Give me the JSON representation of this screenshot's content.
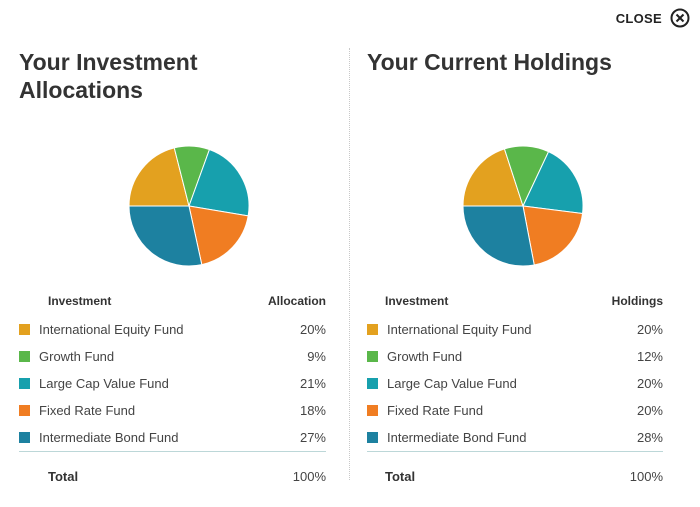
{
  "close": {
    "label": "CLOSE"
  },
  "left": {
    "title_line1": "Your Investment",
    "title_line2": "Allocations",
    "col_investment": "Investment",
    "col_value": "Allocation",
    "rows": [
      {
        "name": "International Equity Fund",
        "value": "20%",
        "color": "#e3a11f"
      },
      {
        "name": "Growth Fund",
        "value": "9%",
        "color": "#5ab74a"
      },
      {
        "name": "Large Cap Value Fund",
        "value": "21%",
        "color": "#17a0ad"
      },
      {
        "name": "Fixed Rate Fund",
        "value": "18%",
        "color": "#f07d22"
      },
      {
        "name": "Intermediate Bond Fund",
        "value": "27%",
        "color": "#1d81a0"
      }
    ],
    "total_label": "Total",
    "total_value": "100%"
  },
  "right": {
    "title": "Your Current Holdings",
    "col_investment": "Investment",
    "col_value": "Holdings",
    "rows": [
      {
        "name": "International Equity Fund",
        "value": "20%",
        "color": "#e3a11f"
      },
      {
        "name": "Growth Fund",
        "value": "12%",
        "color": "#5ab74a"
      },
      {
        "name": "Large Cap Value Fund",
        "value": "20%",
        "color": "#17a0ad"
      },
      {
        "name": "Fixed Rate Fund",
        "value": "20%",
        "color": "#f07d22"
      },
      {
        "name": "Intermediate Bond Fund",
        "value": "28%",
        "color": "#1d81a0"
      }
    ],
    "total_label": "Total",
    "total_value": "100%"
  },
  "chart_data": [
    {
      "type": "pie",
      "categories": [
        "International Equity Fund",
        "Growth Fund",
        "Large Cap Value Fund",
        "Fixed Rate Fund",
        "Intermediate Bond Fund"
      ],
      "values": [
        20,
        9,
        21,
        18,
        27
      ],
      "colors": [
        "#e3a11f",
        "#5ab74a",
        "#17a0ad",
        "#f07d22",
        "#1d81a0"
      ]
    },
    {
      "type": "pie",
      "categories": [
        "International Equity Fund",
        "Growth Fund",
        "Large Cap Value Fund",
        "Fixed Rate Fund",
        "Intermediate Bond Fund"
      ],
      "values": [
        20,
        12,
        20,
        20,
        28
      ],
      "colors": [
        "#e3a11f",
        "#5ab74a",
        "#17a0ad",
        "#f07d22",
        "#1d81a0"
      ]
    }
  ]
}
